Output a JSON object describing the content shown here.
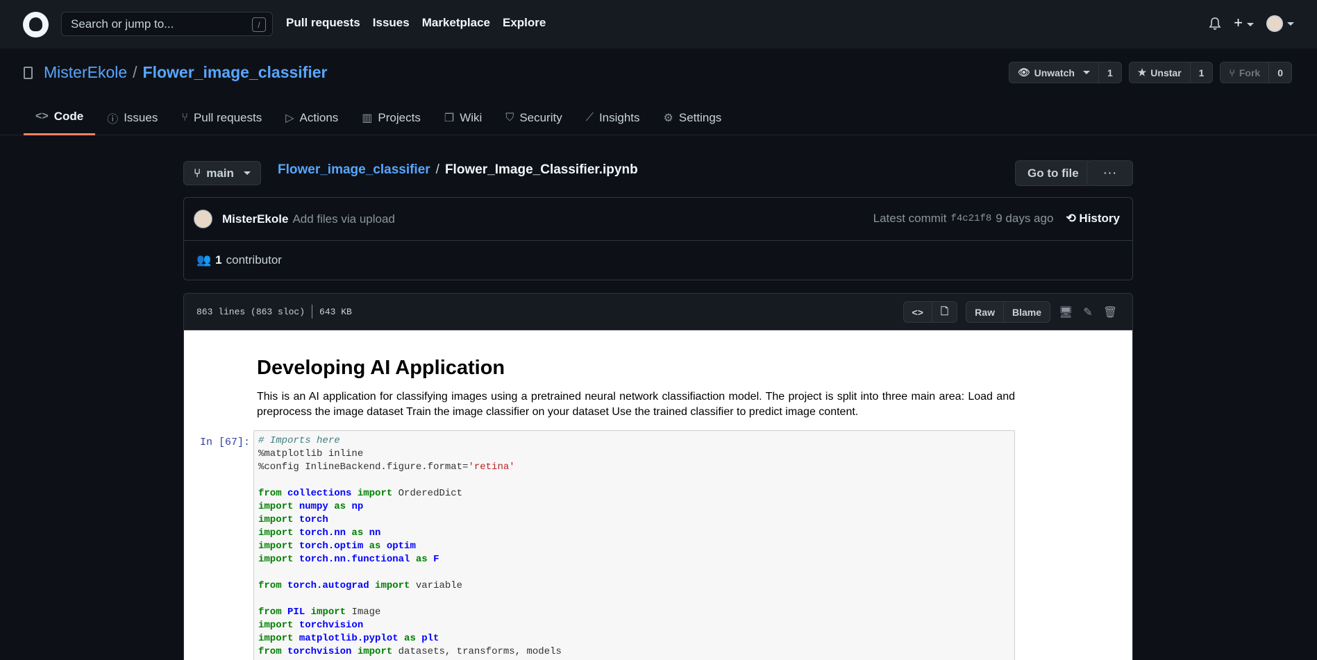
{
  "header": {
    "search_placeholder": "Search or jump to...",
    "slash_key": "/",
    "nav": [
      "Pull requests",
      "Issues",
      "Marketplace",
      "Explore"
    ],
    "plus": "+"
  },
  "repo": {
    "owner": "MisterEkole",
    "separator": "/",
    "name": "Flower_image_classifier",
    "watch_label": "Unwatch",
    "watch_count": "1",
    "star_label": "Unstar",
    "star_count": "1",
    "fork_label": "Fork",
    "fork_count": "0",
    "tabs": [
      {
        "label": "Code",
        "icon": "code-icon",
        "glyph": "<>"
      },
      {
        "label": "Issues",
        "icon": "issue-icon",
        "glyph": "ⓘ"
      },
      {
        "label": "Pull requests",
        "icon": "pull-request-icon",
        "glyph": "⑂"
      },
      {
        "label": "Actions",
        "icon": "play-icon",
        "glyph": "▷"
      },
      {
        "label": "Projects",
        "icon": "project-icon",
        "glyph": "▥"
      },
      {
        "label": "Wiki",
        "icon": "book-icon",
        "glyph": "❐"
      },
      {
        "label": "Security",
        "icon": "shield-icon",
        "glyph": "⛉"
      },
      {
        "label": "Insights",
        "icon": "graph-icon",
        "glyph": "⟋"
      },
      {
        "label": "Settings",
        "icon": "gear-icon",
        "glyph": "⚙"
      }
    ]
  },
  "file_nav": {
    "branch": "main",
    "crumb_repo": "Flower_image_classifier",
    "crumb_sep": "/",
    "crumb_file": "Flower_Image_Classifier.ipynb",
    "goto_label": "Go to file",
    "more_label": "···"
  },
  "commit": {
    "author": "MisterEkole",
    "message": "Add files via upload",
    "latest_label": "Latest commit",
    "sha": "f4c21f8",
    "age": "9 days ago",
    "history_label": "History",
    "contributors": "1",
    "contributors_label": "contributor"
  },
  "file": {
    "lines": "863 lines (863 sloc)",
    "size": "643 KB",
    "raw_label": "Raw",
    "blame_label": "Blame"
  },
  "notebook": {
    "title": "Developing AI Application",
    "description": "This is an AI application for classifying images using a pretrained neural network classifiaction model. The project is split into three main area: Load and preprocess the image dataset Train the image classifier on your dataset Use the trained classifier to predict image content.",
    "prompt": "In [67]:",
    "code_lines": [
      [
        [
          "c-comment",
          "# Imports here"
        ]
      ],
      [
        [
          "",
          "%matplotlib inline"
        ]
      ],
      [
        [
          "",
          "%config InlineBackend.figure.format="
        ],
        [
          "c-str",
          "'retina'"
        ]
      ],
      [],
      [
        [
          "c-kw",
          "from "
        ],
        [
          "c-mod",
          "collections"
        ],
        [
          "c-kw",
          " import "
        ],
        [
          "",
          "OrderedDict"
        ]
      ],
      [
        [
          "c-kw",
          "import "
        ],
        [
          "c-mod",
          "numpy"
        ],
        [
          "c-kw",
          " as "
        ],
        [
          "c-mod",
          "np"
        ]
      ],
      [
        [
          "c-kw",
          "import "
        ],
        [
          "c-mod",
          "torch"
        ]
      ],
      [
        [
          "c-kw",
          "import "
        ],
        [
          "c-mod",
          "torch.nn"
        ],
        [
          "c-kw",
          " as "
        ],
        [
          "c-mod",
          "nn"
        ]
      ],
      [
        [
          "c-kw",
          "import "
        ],
        [
          "c-mod",
          "torch.optim"
        ],
        [
          "c-kw",
          " as "
        ],
        [
          "c-mod",
          "optim"
        ]
      ],
      [
        [
          "c-kw",
          "import "
        ],
        [
          "c-mod",
          "torch.nn.functional"
        ],
        [
          "c-kw",
          " as "
        ],
        [
          "c-mod",
          "F"
        ]
      ],
      [],
      [
        [
          "c-kw",
          "from "
        ],
        [
          "c-mod",
          "torch.autograd"
        ],
        [
          "c-kw",
          " import "
        ],
        [
          "",
          "variable"
        ]
      ],
      [],
      [
        [
          "c-kw",
          "from "
        ],
        [
          "c-mod",
          "PIL"
        ],
        [
          "c-kw",
          " import "
        ],
        [
          "",
          "Image"
        ]
      ],
      [
        [
          "c-kw",
          "import "
        ],
        [
          "c-mod",
          "torchvision"
        ]
      ],
      [
        [
          "c-kw",
          "import "
        ],
        [
          "c-mod",
          "matplotlib.pyplot"
        ],
        [
          "c-kw",
          " as "
        ],
        [
          "c-mod",
          "plt"
        ]
      ],
      [
        [
          "c-kw",
          "from "
        ],
        [
          "c-mod",
          "torchvision"
        ],
        [
          "c-kw",
          " import "
        ],
        [
          "",
          "datasets, transforms, models"
        ]
      ]
    ]
  }
}
